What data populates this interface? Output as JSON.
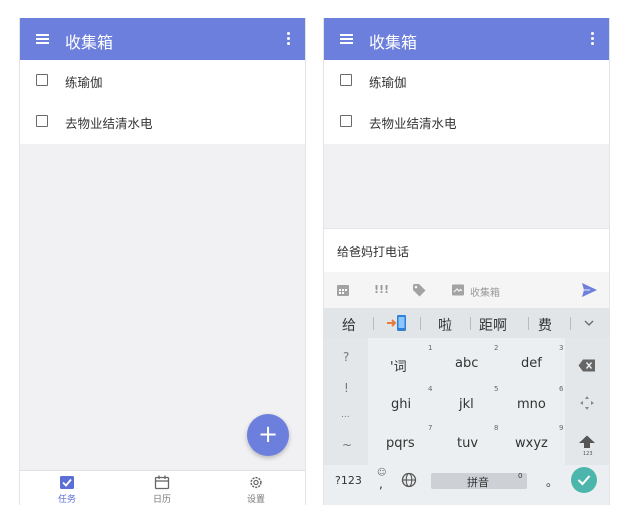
{
  "left": {
    "title": "收集箱",
    "tasks": [
      "练瑜伽",
      "去物业结清水电"
    ],
    "fab": "+",
    "nav": [
      {
        "label": "任务",
        "icon": "check-square-icon",
        "active": true
      },
      {
        "label": "日历",
        "icon": "calendar-icon",
        "active": false
      },
      {
        "label": "设置",
        "icon": "gear-icon",
        "active": false
      }
    ]
  },
  "right": {
    "title": "收集箱",
    "tasks": [
      "练瑜伽",
      "去物业结清水电"
    ],
    "new_task_text": "给爸妈打电话",
    "toolbar": {
      "priority": "!!!",
      "list_label": "收集箱"
    },
    "candidates": [
      "给",
      "啦",
      "距啊",
      "费"
    ],
    "keys": {
      "row1": [
        {
          "label": "'词",
          "num": "1"
        },
        {
          "label": "abc",
          "num": "2"
        },
        {
          "label": "def",
          "num": "3"
        }
      ],
      "row2": [
        {
          "label": "ghi",
          "num": "4"
        },
        {
          "label": "jkl",
          "num": "5"
        },
        {
          "label": "mno",
          "num": "6"
        }
      ],
      "row3": [
        {
          "label": "pqrs",
          "num": "7"
        },
        {
          "label": "tuv",
          "num": "8"
        },
        {
          "label": "wxyz",
          "num": "9"
        }
      ],
      "symbols": [
        "?",
        "!",
        "...",
        "~"
      ],
      "shift_caption": "123",
      "mode_key": "?123",
      "emoji_key": "☺",
      "comma": ",",
      "space_label": "拼音",
      "space_num": "0",
      "period": "。"
    }
  },
  "colors": {
    "accent": "#6c7fdc",
    "enter": "#4db6ac"
  }
}
